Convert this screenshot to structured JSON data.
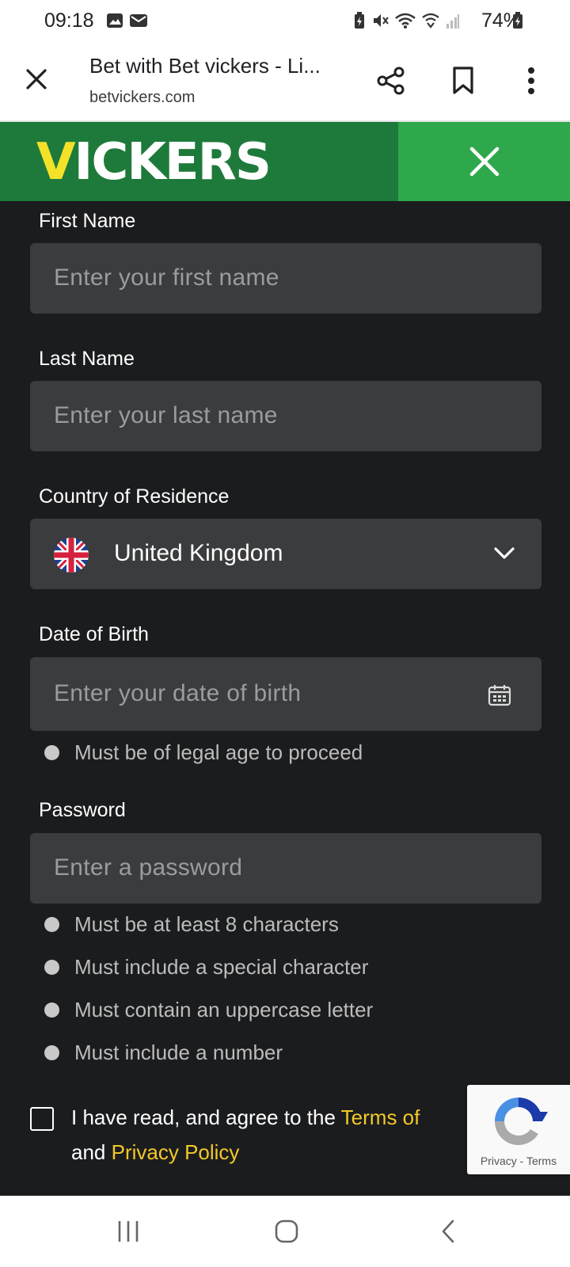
{
  "status_bar": {
    "time": "09:18",
    "battery": "74%",
    "icons": [
      "gallery-icon",
      "mail-icon",
      "battery-saver-icon",
      "mute-icon",
      "wifi-icon",
      "wifi-calling-icon",
      "signal-icon",
      "battery-icon"
    ]
  },
  "browser": {
    "page_title": "Bet with Bet vickers - Li...",
    "url": "betvickers.com",
    "icons": [
      "close-icon",
      "share-icon",
      "bookmark-icon",
      "more-vert-icon"
    ]
  },
  "header": {
    "logo_first": "V",
    "logo_rest": "ICKERS",
    "brand_color": "#1e7a3a",
    "accent_color": "#2ea84a",
    "logo_accent": "#f4e229"
  },
  "form": {
    "first_name": {
      "label": "First Name",
      "placeholder": "Enter your first name"
    },
    "last_name": {
      "label": "Last Name",
      "placeholder": "Enter your last name"
    },
    "country": {
      "label": "Country of Residence",
      "value": "United Kingdom",
      "flag": "uk-flag-icon"
    },
    "dob": {
      "label": "Date of Birth",
      "placeholder": "Enter your date of birth",
      "rules": [
        "Must be of legal age to proceed"
      ]
    },
    "password": {
      "label": "Password",
      "placeholder": "Enter a password",
      "rules": [
        "Must be at least 8 characters",
        "Must include a special character",
        "Must contain an uppercase letter",
        "Must include a number"
      ]
    },
    "agree": {
      "pre": "I have read, and agree to the ",
      "terms_link": "Terms of",
      "mid": "and ",
      "privacy_link": "Privacy Policy",
      "link_color": "#f2c928"
    }
  },
  "recaptcha": {
    "privacy": "Privacy",
    "separator": " - ",
    "terms": "Terms"
  },
  "navbar": {
    "icons": [
      "recents-icon",
      "home-icon",
      "back-icon"
    ]
  }
}
